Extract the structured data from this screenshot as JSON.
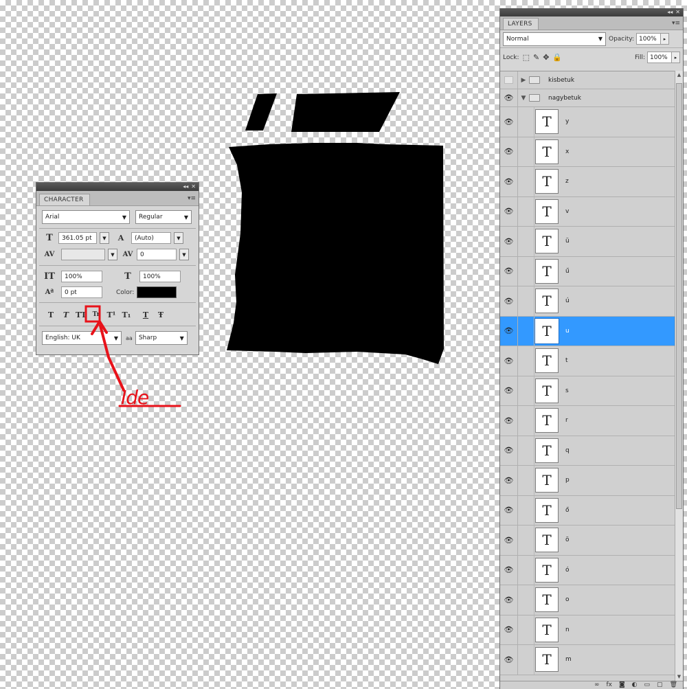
{
  "character_panel": {
    "title": "CHARACTER",
    "menu_glyph": "▾≡",
    "topbar_glyphs": [
      "◂◂",
      "✕"
    ],
    "font_family": "Arial",
    "font_style": "Regular",
    "font_size": "361.05 pt",
    "leading": "(Auto)",
    "kerning": "",
    "tracking": "0",
    "vertical_scale": "100%",
    "horizontal_scale": "100%",
    "baseline_shift": "0 pt",
    "color_label": "Color:",
    "color_value": "#000000",
    "style_buttons": [
      "T",
      "T",
      "TT",
      "Tr",
      "T¹",
      "T₁",
      "T",
      "Ŧ"
    ],
    "language": "English: UK",
    "antialias_icon_label": "aa",
    "antialias": "Sharp"
  },
  "annotation": {
    "text": "Ide",
    "color": "#e8121a"
  },
  "layers_panel": {
    "title": "LAYERS",
    "menu_glyph": "▾≡",
    "topbar_glyphs": [
      "◂◂",
      "✕"
    ],
    "blend_mode": "Normal",
    "opacity_label": "Opacity:",
    "opacity_value": "100%",
    "lock_label": "Lock:",
    "fill_label": "Fill:",
    "fill_value": "100%",
    "groups": [
      {
        "name": "kisbetuk",
        "visible": false,
        "expanded": false
      },
      {
        "name": "nagybetuk",
        "visible": true,
        "expanded": true
      }
    ],
    "layers": [
      {
        "name": "y",
        "selected": false
      },
      {
        "name": "x",
        "selected": false
      },
      {
        "name": "z",
        "selected": false
      },
      {
        "name": "v",
        "selected": false
      },
      {
        "name": "ü",
        "selected": false
      },
      {
        "name": "ű",
        "selected": false
      },
      {
        "name": "ú",
        "selected": false
      },
      {
        "name": "u",
        "selected": true
      },
      {
        "name": "t",
        "selected": false
      },
      {
        "name": "s",
        "selected": false
      },
      {
        "name": "r",
        "selected": false
      },
      {
        "name": "q",
        "selected": false
      },
      {
        "name": "p",
        "selected": false
      },
      {
        "name": "ő",
        "selected": false
      },
      {
        "name": "ö",
        "selected": false
      },
      {
        "name": "ó",
        "selected": false
      },
      {
        "name": "o",
        "selected": false
      },
      {
        "name": "n",
        "selected": false
      },
      {
        "name": "m",
        "selected": false
      }
    ],
    "thumb_glyph": "T",
    "eye_glyph": "👁",
    "footer_icons": [
      "∞",
      "fx",
      "◙",
      "◐",
      "▭",
      "▢",
      "🗑"
    ]
  }
}
